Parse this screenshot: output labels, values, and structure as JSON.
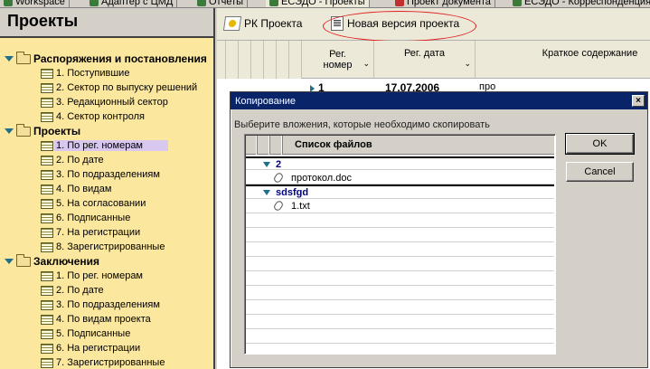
{
  "tabs": [
    {
      "label": "Workspace"
    },
    {
      "label": "Адаптер с ЦМД"
    },
    {
      "label": "Отчеты"
    },
    {
      "label": "ЕСЭДО - Проекты"
    },
    {
      "label": "Проект документа"
    },
    {
      "label": "ЕСЭДО - Корреспонденция"
    }
  ],
  "left_panel": {
    "title": "Проекты",
    "groups": [
      {
        "label": "Распоряжения и постановления",
        "items": [
          "1. Поступившие",
          "2. Сектор по выпуску решений",
          "3. Редакционный сектор",
          "4. Сектор контроля"
        ]
      },
      {
        "label": "Проекты",
        "items": [
          "1. По рег. номерам",
          "2. По дате",
          "3. По подразделениям",
          "4. По видам",
          "5. На согласовании",
          "6. Подписанные",
          "7. На регистрации",
          "8. Зарегистрированные"
        ]
      },
      {
        "label": "Заключения",
        "items": [
          "1. По рег. номерам",
          "2. По дате",
          "3. По подразделениям",
          "4. По видам проекта",
          "5. Подписанные",
          "6. На регистрации",
          "7. Зарегистрированные"
        ]
      }
    ]
  },
  "toolbar": {
    "rk_label": "РК Проекта",
    "new_version_label": "Новая версия проекта"
  },
  "grid": {
    "col_reg_num_l1": "Рег.",
    "col_reg_num_l2": "номер",
    "col_reg_date": "Рег. дата",
    "col_summary": "Краткое содержание",
    "row1": {
      "num": "1",
      "date": "17.07.2006",
      "summary": "про"
    }
  },
  "dialog": {
    "title": "Копирование",
    "prompt": "Выберите вложения, которые необходимо скопировать",
    "list_header": "Список файлов",
    "rows": [
      {
        "type": "group",
        "label": "2"
      },
      {
        "type": "file",
        "label": "протокол.doc"
      },
      {
        "type": "group",
        "label": "sdsfgd"
      },
      {
        "type": "file",
        "label": "1.txt"
      }
    ],
    "ok_label": "OK",
    "cancel_label": "Cancel",
    "close_glyph": "×"
  }
}
